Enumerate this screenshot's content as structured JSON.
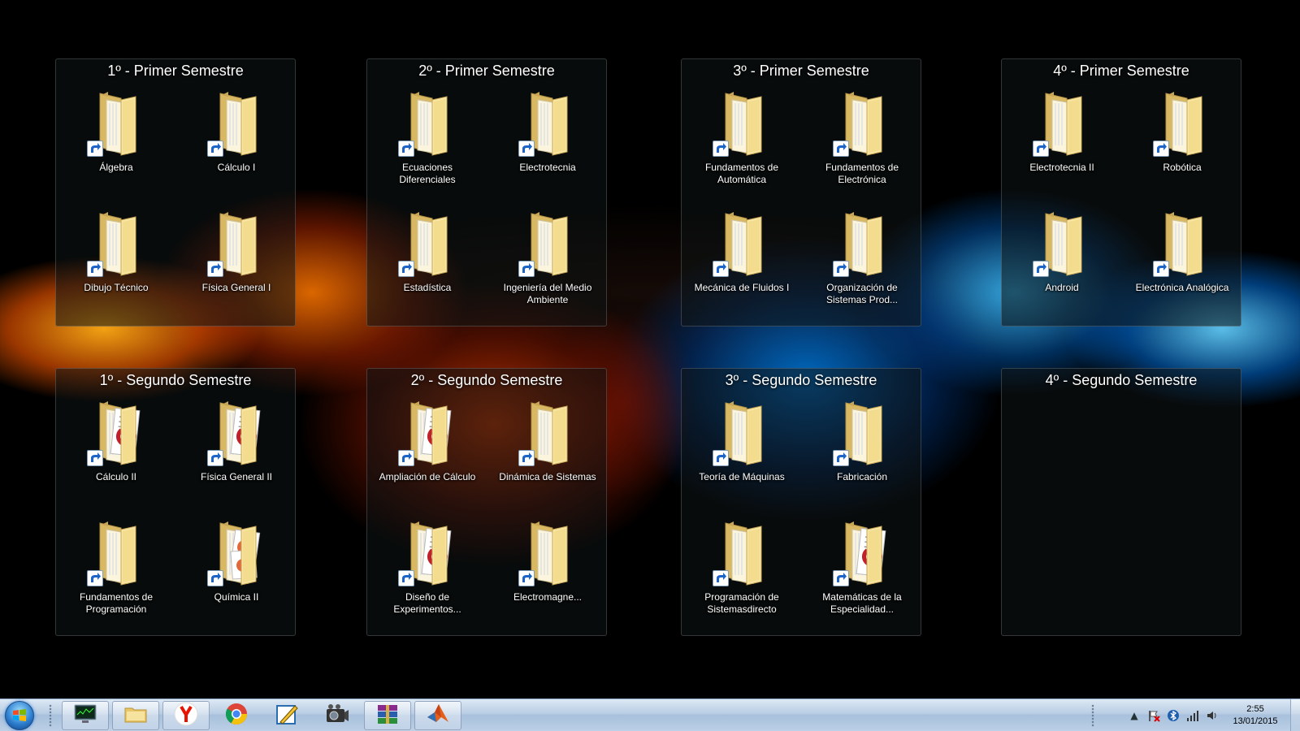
{
  "colors": {
    "fence_background": "#0f1414",
    "label_text": "#ffffff",
    "folder_light": "#f7e6a4",
    "folder_dark": "#d9b863",
    "taskbar": "#b9cde3"
  },
  "fences": [
    {
      "title": "1º - Primer Semestre",
      "items": [
        {
          "label": "Álgebra",
          "icon": "folder-icon"
        },
        {
          "label": "Cálculo I",
          "icon": "folder-icon"
        },
        {
          "label": "Dibujo Técnico",
          "icon": "folder-icon"
        },
        {
          "label": "Física General I",
          "icon": "folder-icon"
        }
      ]
    },
    {
      "title": "2º - Primer Semestre",
      "items": [
        {
          "label": "Ecuaciones Diferenciales",
          "icon": "folder-icon"
        },
        {
          "label": "Electrotecnia",
          "icon": "folder-icon"
        },
        {
          "label": "Estadística",
          "icon": "folder-icon"
        },
        {
          "label": "Ingeniería del Medio Ambiente",
          "icon": "folder-icon"
        }
      ]
    },
    {
      "title": "3º - Primer Semestre",
      "items": [
        {
          "label": "Fundamentos de Automática",
          "icon": "folder-icon"
        },
        {
          "label": "Fundamentos de Electrónica",
          "icon": "folder-icon"
        },
        {
          "label": "Mecánica de Fluidos I",
          "icon": "folder-icon"
        },
        {
          "label": "Organización de Sistemas Prod...",
          "icon": "folder-icon"
        }
      ]
    },
    {
      "title": "4º - Primer Semestre",
      "items": [
        {
          "label": "Electrotecnia II",
          "icon": "folder-icon"
        },
        {
          "label": "Robótica",
          "icon": "folder-icon"
        },
        {
          "label": "Android",
          "icon": "folder-icon"
        },
        {
          "label": "Electrónica Analógica",
          "icon": "folder-icon"
        }
      ]
    },
    {
      "title": "1º - Segundo Semestre",
      "items": [
        {
          "label": "Cálculo II",
          "icon": "folder-with-document-icon"
        },
        {
          "label": "Física General II",
          "icon": "folder-with-document-icon"
        },
        {
          "label": "Fundamentos de Programación",
          "icon": "folder-icon"
        },
        {
          "label": "Química II",
          "icon": "folder-with-slides-icon"
        }
      ]
    },
    {
      "title": "2º - Segundo Semestre",
      "items": [
        {
          "label": "Ampliación de Cálculo",
          "icon": "folder-with-document-icon"
        },
        {
          "label": "Dinámica de Sistemas",
          "icon": "folder-icon"
        },
        {
          "label": "Diseño de Experimentos...",
          "icon": "folder-with-document-icon"
        },
        {
          "label": "Electromagne...",
          "icon": "folder-icon"
        }
      ]
    },
    {
      "title": "3º - Segundo Semestre",
      "items": [
        {
          "label": "Teoría de Máquinas",
          "icon": "folder-icon"
        },
        {
          "label": "Fabricación",
          "icon": "folder-icon"
        },
        {
          "label": "Programación de Sistemasdirecto",
          "icon": "folder-icon"
        },
        {
          "label": "Matemáticas de la Especialidad...",
          "icon": "folder-with-document-icon"
        }
      ]
    },
    {
      "title": "4º - Segundo Semestre",
      "items": []
    }
  ],
  "taskbar": {
    "buttons": [
      {
        "name": "task-manager",
        "icon": "monitor-icon",
        "open": true
      },
      {
        "name": "file-explorer",
        "icon": "folder-icon",
        "open": true
      },
      {
        "name": "yandex-browser",
        "icon": "yandex-icon",
        "open": true
      },
      {
        "name": "chrome",
        "icon": "chrome-icon",
        "open": false
      },
      {
        "name": "pen-app",
        "icon": "pen-icon",
        "open": false
      },
      {
        "name": "video-app",
        "icon": "film-camera-icon",
        "open": false
      },
      {
        "name": "winrar",
        "icon": "books-icon",
        "open": true
      },
      {
        "name": "matlab",
        "icon": "matlab-icon",
        "open": true
      }
    ],
    "clock": {
      "time": "2:55",
      "date": "13/01/2015"
    }
  }
}
